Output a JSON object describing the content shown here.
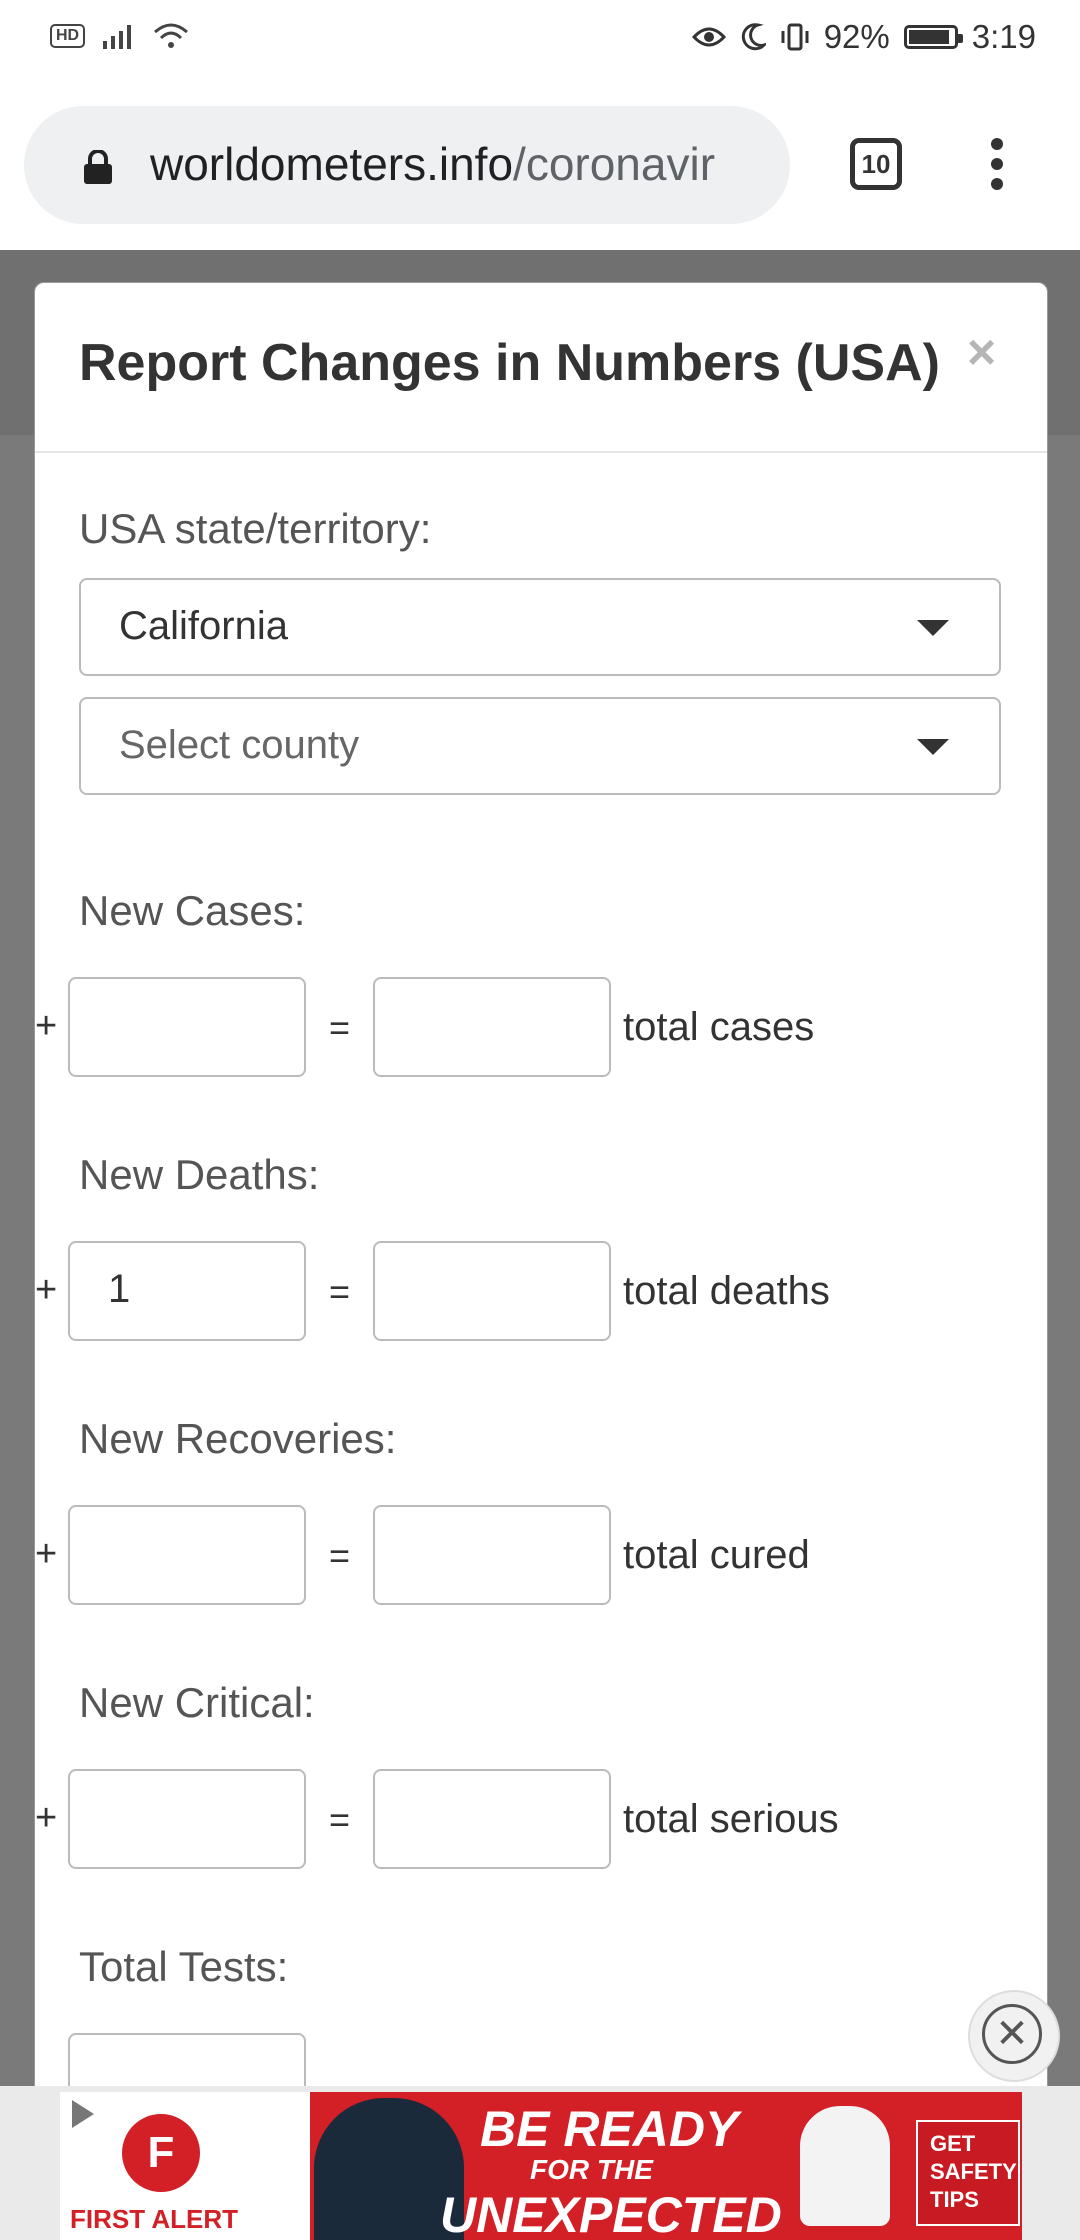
{
  "status_bar": {
    "hd": "HD",
    "battery_percent": "92%",
    "battery_level": 0.92,
    "time": "3:19"
  },
  "browser": {
    "url_domain": "worldometers.info",
    "url_path": "/coronavir",
    "tab_count": "10"
  },
  "modal": {
    "title": "Report Changes in Numbers (USA)",
    "close_symbol": "×",
    "state_label": "USA state/territory:",
    "state_value": "California",
    "county_placeholder": "Select county",
    "sections": [
      {
        "label": "New Cases:",
        "plus": "+",
        "new_value": "",
        "eq": "=",
        "total_value": "",
        "total_label": "total cases"
      },
      {
        "label": "New Deaths:",
        "plus": "+",
        "new_value": "1",
        "eq": "=",
        "total_value": "",
        "total_label": "total deaths"
      },
      {
        "label": "New Recoveries:",
        "plus": "+",
        "new_value": "",
        "eq": "=",
        "total_value": "",
        "total_label": "total cured"
      },
      {
        "label": "New Critical:",
        "plus": "+",
        "new_value": "",
        "eq": "=",
        "total_value": "",
        "total_label": "total serious"
      }
    ],
    "tests_label": "Total Tests:"
  },
  "ad": {
    "brand": "FIRST ALERT",
    "headline_1": "BE READY",
    "headline_2": "FOR THE",
    "headline_3": "UNEXPECTED",
    "cta": "GET SAFETY TIPS",
    "close_symbol": "✕"
  },
  "colors": {
    "ad_red": "#d31f26",
    "overlay": "#7a7a7a"
  }
}
